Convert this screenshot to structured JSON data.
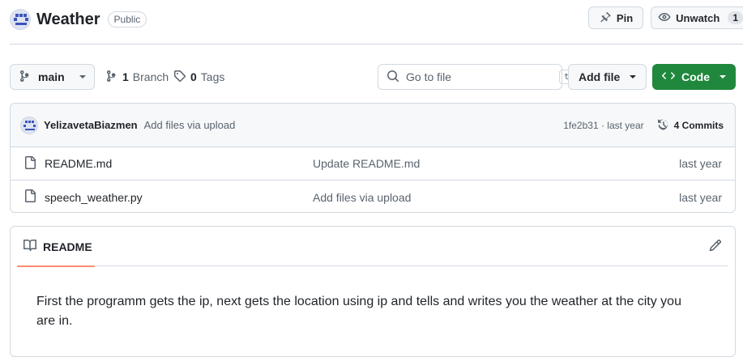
{
  "header": {
    "repo_name": "Weather",
    "visibility": "Public",
    "pin_label": "Pin",
    "unwatch_label": "Unwatch",
    "watch_count": "1"
  },
  "toolbar": {
    "branch": "main",
    "branch_count": "1",
    "branch_label": "Branch",
    "tag_count": "0",
    "tag_label": "Tags",
    "goto_placeholder": "Go to file",
    "goto_shortcut": "t",
    "add_file_label": "Add file",
    "code_label": "Code"
  },
  "latest_commit": {
    "author": "YelizavetaBiazmen",
    "message": "Add files via upload",
    "hash_time": "1fe2b31 · last year",
    "commits_label": "4 Commits"
  },
  "files": [
    {
      "name": "README.md",
      "commit": "Update README.md",
      "date": "last year"
    },
    {
      "name": "speech_weather.py",
      "commit": "Add files via upload",
      "date": "last year"
    }
  ],
  "readme": {
    "tab_label": "README",
    "text": "First the programm gets the ip, next gets the location using ip and tells and writes you the weather at the city you are in."
  },
  "colors": {
    "code_button": "#1f883d",
    "tab_underline": "#fd8c73",
    "border": "#d1d9e0"
  }
}
